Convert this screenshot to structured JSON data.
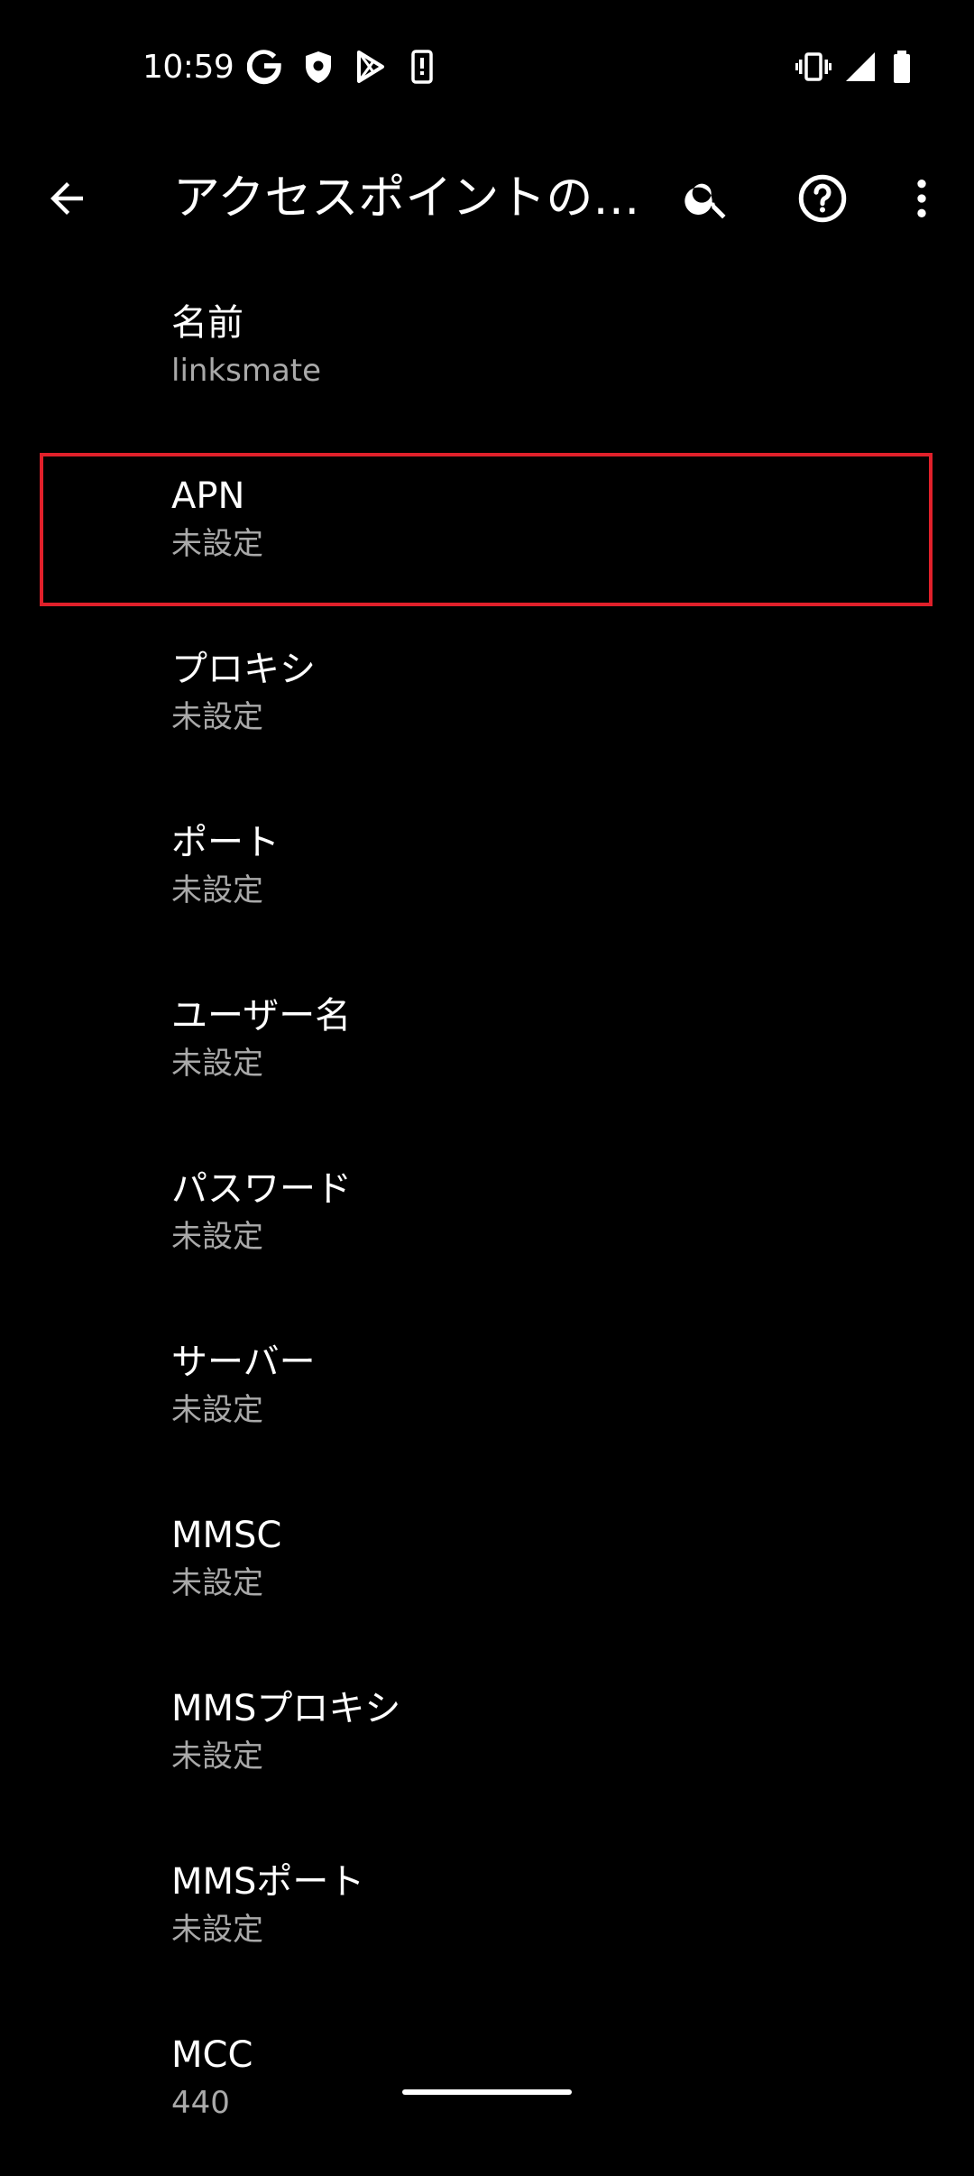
{
  "status_bar": {
    "time": "10:59",
    "icons_left": [
      "google-icon",
      "shield-icon",
      "play-store-icon",
      "phone-alert-icon"
    ],
    "icons_right": [
      "vibrate-icon",
      "signal-icon",
      "battery-icon"
    ]
  },
  "app_bar": {
    "title": "アクセスポイントの…",
    "icons": [
      "back-arrow-icon",
      "search-icon",
      "help-icon",
      "more-vert-icon"
    ]
  },
  "highlight_color": "#e0202a",
  "items": [
    {
      "title": "名前",
      "summary": "linksmate"
    },
    {
      "title": "APN",
      "summary": "未設定"
    },
    {
      "title": "プロキシ",
      "summary": "未設定"
    },
    {
      "title": "ポート",
      "summary": "未設定"
    },
    {
      "title": "ユーザー名",
      "summary": "未設定"
    },
    {
      "title": "パスワード",
      "summary": "未設定"
    },
    {
      "title": "サーバー",
      "summary": "未設定"
    },
    {
      "title": "MMSC",
      "summary": "未設定"
    },
    {
      "title": "MMSプロキシ",
      "summary": "未設定"
    },
    {
      "title": "MMSポート",
      "summary": "未設定"
    },
    {
      "title": "MCC",
      "summary": "440"
    }
  ]
}
